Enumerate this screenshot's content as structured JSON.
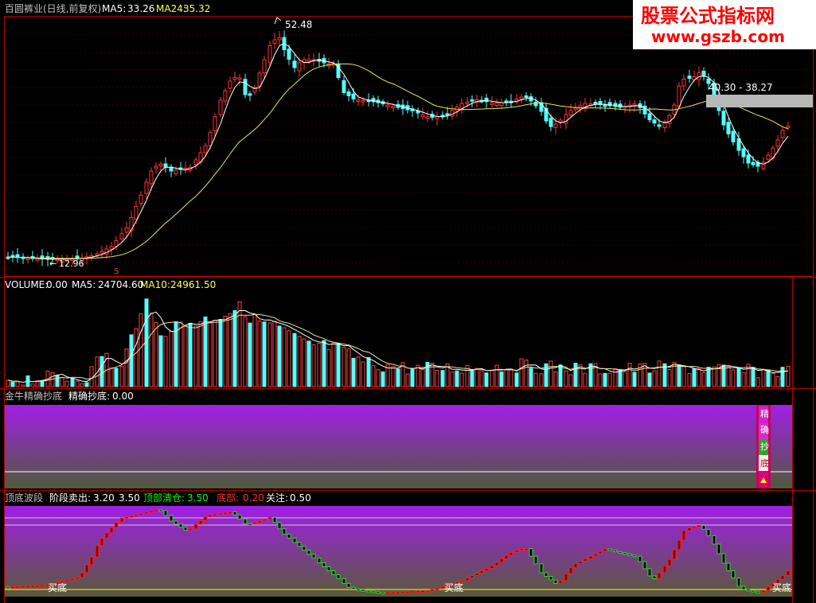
{
  "price_panel": {
    "name": "百圆裤业(日线,前复权)",
    "ma5_label": "MA5:",
    "ma5_value": "33.26",
    "ma24_label": "MA24:",
    "ma24_value": "35.32",
    "high_marker": "52.48",
    "low_marker": "12.96",
    "range_box": "40.30 - 38.27",
    "signal_s": "S"
  },
  "volume_panel": {
    "label": "VOLUME:",
    "value": "0.00",
    "ma5_label": "MA5:",
    "ma5_value": "24704.60",
    "ma10_label": "MA10:",
    "ma10_value": "24961.50"
  },
  "indicator1": {
    "title": "金牛精确抄底",
    "field_label": "精确抄底:",
    "field_value": "0.00",
    "blocks": [
      "精",
      "确",
      "抄",
      "底"
    ]
  },
  "indicator2": {
    "title": "顶底波段",
    "stage_sell_label": "阶段卖出:",
    "stage_sell_v1": "3.20",
    "stage_sell_v2": "3.50",
    "top_clear_label": "顶部清仓:",
    "top_clear_value": "3.50",
    "bottom_label": "底部:",
    "bottom_value": "0.20",
    "attention_label": "关注:",
    "attention_value": "0.50",
    "buy_labels": [
      "买底",
      "买底",
      "买底"
    ]
  },
  "watermark": {
    "line1": "股票公式指标网",
    "line2": "www.gszb.com"
  },
  "colors": {
    "up": "#ff3232",
    "down": "#54ffff",
    "ma_short": "#ffffff",
    "ma_long": "#ffff66",
    "panel_border": "#c00000",
    "top_clear": "#00ff00",
    "bottom": "#ff3232",
    "watermark": "#ff0000"
  }
}
